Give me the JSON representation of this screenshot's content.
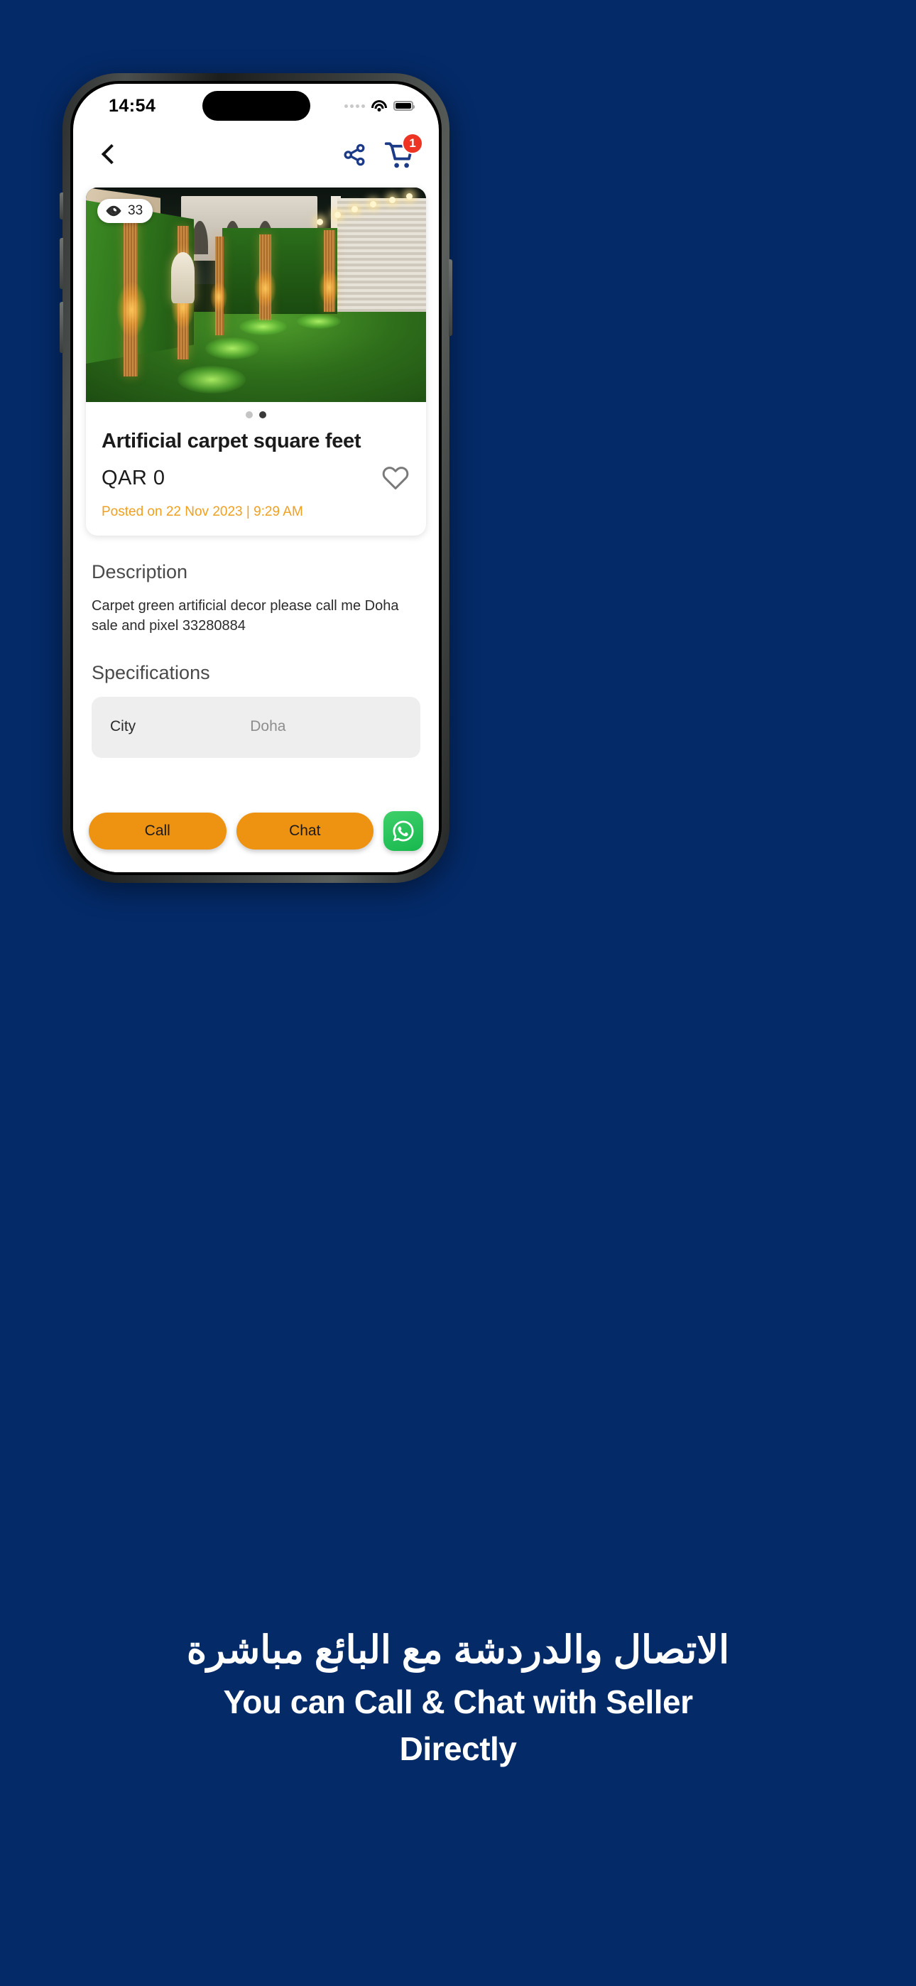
{
  "theme": {
    "background": "#042a68",
    "brand_navy": "#1b3b86",
    "accent_orange": "#ee9311",
    "posted_orange": "#f0a020",
    "badge_red": "#ee3524",
    "whatsapp_green": "#25D366"
  },
  "status_bar": {
    "time": "14:54",
    "signal_icon": "signal-dots-icon",
    "wifi_icon": "wifi-icon",
    "battery_icon": "battery-icon"
  },
  "nav_bar": {
    "back_icon": "back-chevron-icon",
    "share_icon": "share-icon",
    "cart_icon": "shopping-cart-icon",
    "cart_badge": "1"
  },
  "product": {
    "views_icon": "eye-icon",
    "views_count": "33",
    "title": "Artificial carpet square feet",
    "price": "QAR  0",
    "favorite_icon": "heart-outline-icon",
    "posted": "Posted on 22 Nov 2023 | 9:29 AM",
    "carousel": {
      "total_dots": 2,
      "active_index": 1
    }
  },
  "description": {
    "heading": "Description",
    "body": "Carpet green artificial decor please call me Doha sale and pixel 33280884"
  },
  "specifications": {
    "heading": "Specifications",
    "rows": [
      {
        "key": "City",
        "value": "Doha"
      }
    ]
  },
  "actions": {
    "call_label": "Call",
    "chat_label": "Chat",
    "whatsapp_icon": "whatsapp-icon"
  },
  "caption": {
    "arabic": "الاتصال والدردشة مع البائع مباشرة",
    "english_line1": "You can Call & Chat with Seller",
    "english_line2": "Directly"
  }
}
